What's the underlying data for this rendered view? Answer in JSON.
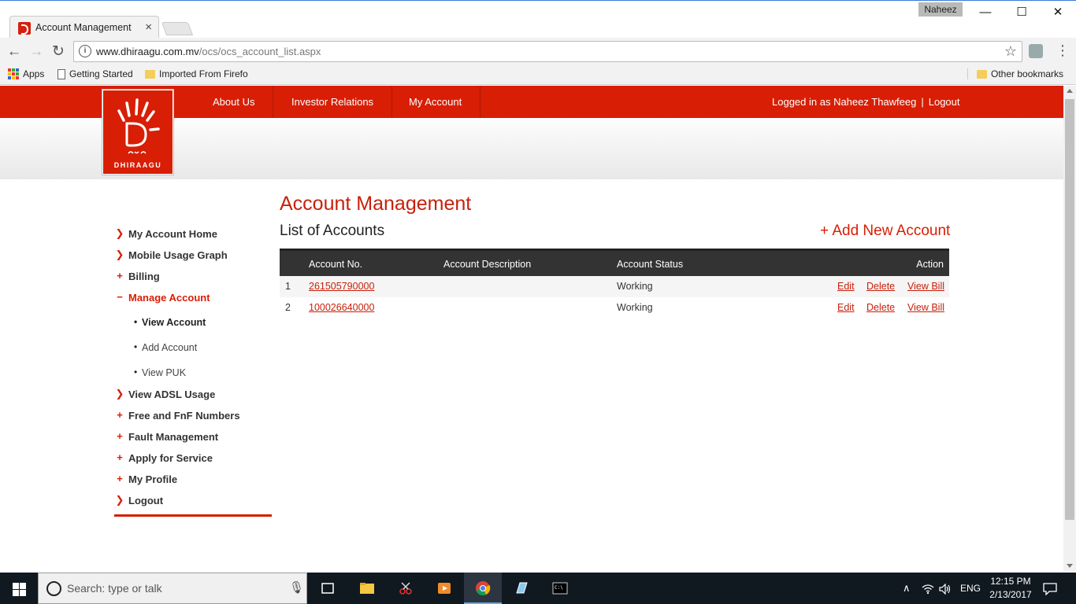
{
  "browser": {
    "tab_title": "Account Management",
    "tab_close": "×",
    "profile_name": "Naheez",
    "url_host": "www.dhiraagu.com.mv",
    "url_path": "/ocs/ocs_account_list.aspx",
    "bookmarks": {
      "apps": "Apps",
      "getting_started": "Getting Started",
      "imported": "Imported From Firefo",
      "other": "Other bookmarks"
    },
    "window_controls": {
      "minimize": "—",
      "maximize": "☐",
      "close": "✕"
    }
  },
  "site": {
    "brand": "DHIRAAGU",
    "nav": [
      "About Us",
      "Investor Relations",
      "My Account"
    ],
    "logged_in_text": "Logged in as Naheez Thawfeeg",
    "separator": "|",
    "logout": "Logout",
    "brand_color": "#d81e05"
  },
  "sidebar": {
    "items": [
      {
        "label": "My Account Home",
        "marker": "❯"
      },
      {
        "label": "Mobile Usage Graph",
        "marker": "❯"
      },
      {
        "label": "Billing",
        "marker": "+"
      },
      {
        "label": "Manage Account",
        "marker": "−"
      },
      {
        "label": "View ADSL Usage",
        "marker": "❯"
      },
      {
        "label": "Free and FnF Numbers",
        "marker": "+"
      },
      {
        "label": "Fault Management",
        "marker": "+"
      },
      {
        "label": "Apply for Service",
        "marker": "+"
      },
      {
        "label": "My Profile",
        "marker": "+"
      },
      {
        "label": "Logout",
        "marker": "❯"
      }
    ],
    "subitems": [
      {
        "label": "View Account"
      },
      {
        "label": "Add Account"
      },
      {
        "label": "View PUK"
      }
    ]
  },
  "main": {
    "title": "Account Management",
    "subtitle": "List of Accounts",
    "add_new": "+ Add New Account",
    "columns": {
      "account_no": "Account No.",
      "description": "Account Description",
      "status": "Account Status",
      "action": "Action"
    },
    "rows": [
      {
        "index": "1",
        "account_no": "261505790000",
        "description": "",
        "status": "Working",
        "edit": "Edit",
        "delete": "Delete",
        "view_bill": "View Bill"
      },
      {
        "index": "2",
        "account_no": "100026640000",
        "description": "",
        "status": "Working",
        "edit": "Edit",
        "delete": "Delete",
        "view_bill": "View Bill"
      }
    ]
  },
  "taskbar": {
    "search_placeholder": "Search: type or talk",
    "language": "ENG",
    "time": "12:15 PM",
    "date": "2/13/2017"
  }
}
